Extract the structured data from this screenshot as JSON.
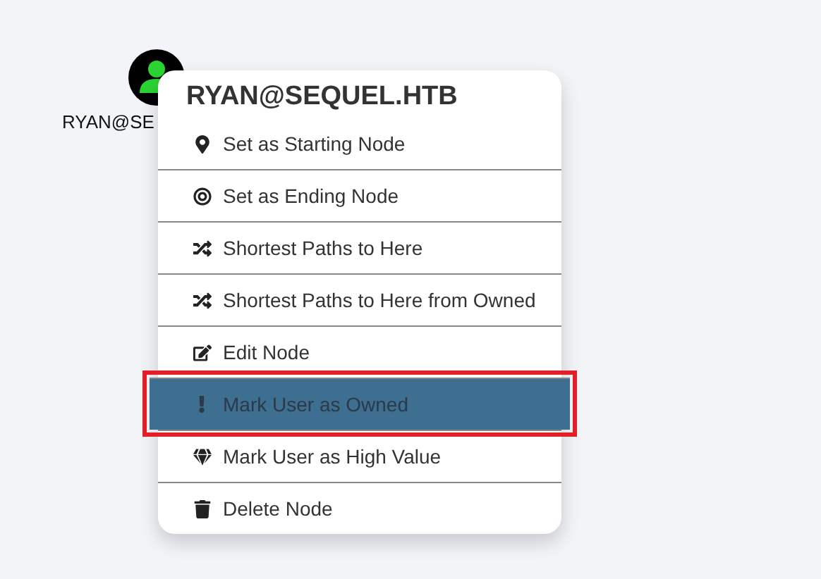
{
  "node": {
    "label": "RYAN@SE"
  },
  "context_menu": {
    "title": "RYAN@SEQUEL.HTB",
    "items": [
      {
        "kind": "start",
        "label": "Set as Starting Node",
        "selected": false
      },
      {
        "kind": "end",
        "label": "Set as Ending Node",
        "selected": false
      },
      {
        "kind": "paths",
        "label": "Shortest Paths to Here",
        "selected": false
      },
      {
        "kind": "paths",
        "label": "Shortest Paths to Here from Owned",
        "selected": false
      },
      {
        "kind": "edit",
        "label": "Edit Node",
        "selected": false
      },
      {
        "kind": "owned",
        "label": "Mark User as Owned",
        "selected": true
      },
      {
        "kind": "value",
        "label": "Mark User as High Value",
        "selected": false
      },
      {
        "kind": "delete",
        "label": "Delete Node",
        "selected": false
      }
    ]
  }
}
